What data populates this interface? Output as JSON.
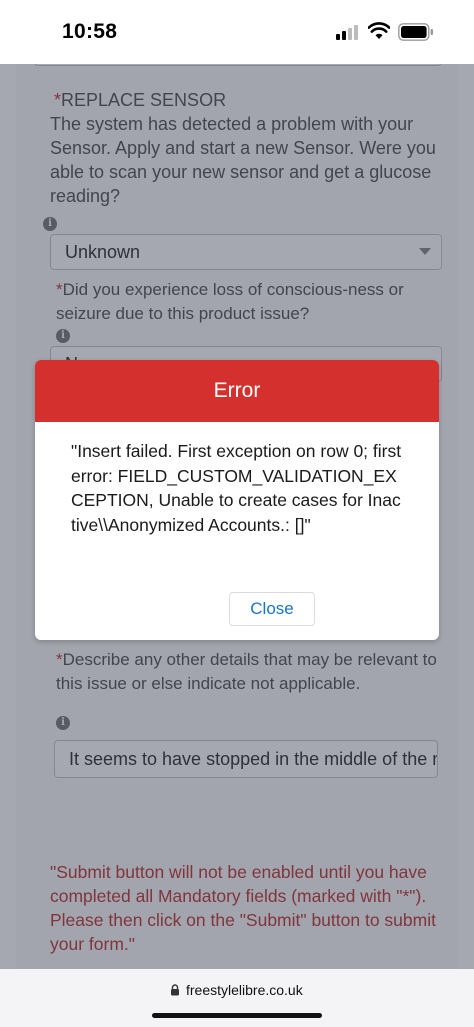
{
  "status_bar": {
    "time": "10:58"
  },
  "form": {
    "q1_required": "*",
    "q1_label": "REPLACE SENSOR",
    "q1_text": "The system has detected a problem with your Sensor. Apply and start a new Sensor. Were you able to scan your new sensor and get a glucose reading?",
    "q1_value": "Unknown",
    "q2_required": "*",
    "q2_text": "Did you experience loss of conscious-ness or seizure due to this product issue?",
    "q2_value": "No",
    "q3_required": "*",
    "q3_text": "Describe any other details that may be relevant to this issue or else indicate not applicable.",
    "q3_value": "It seems to have stopped in the middle of the night",
    "info_glyph": "i",
    "submit_note": "\"Submit button will not be enabled until you have completed all Mandatory fields (marked with \"*\"). Please then click on the \"Submit\" button to submit your form.\""
  },
  "modal": {
    "title": "Error",
    "message": "\"Insert failed. First exception on row 0; first error: FIELD_CUSTOM_VALIDATION_EXCEPTION, Unable to create cases for Inactive\\\\Anonymized Accounts.: []\"",
    "close_label": "Close"
  },
  "browser": {
    "url": "freestylelibre.co.uk"
  },
  "colors": {
    "error_header": "#d3302e",
    "required": "#c23934",
    "link": "#1a74c6"
  }
}
